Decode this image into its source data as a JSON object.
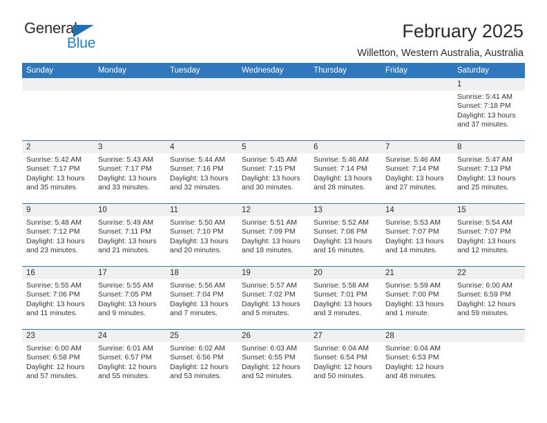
{
  "brand": {
    "name_part1": "General",
    "name_part2": "Blue",
    "triangle_color": "#1d6fb8",
    "blue_text_color": "#1d7fd4"
  },
  "header": {
    "title": "February 2025",
    "subtitle": "Willetton, Western Australia, Australia"
  },
  "theme": {
    "header_blue": "#2f78bd",
    "daynum_gray": "#f0f0f0",
    "text": "#2b2b2b"
  },
  "weekday_headers": [
    "Sunday",
    "Monday",
    "Tuesday",
    "Wednesday",
    "Thursday",
    "Friday",
    "Saturday"
  ],
  "labels": {
    "sunrise": "Sunrise:",
    "sunset": "Sunset:",
    "daylight": "Daylight:"
  },
  "weeks": [
    [
      {
        "empty": true,
        "day": ""
      },
      {
        "empty": true,
        "day": ""
      },
      {
        "empty": true,
        "day": ""
      },
      {
        "empty": true,
        "day": ""
      },
      {
        "empty": true,
        "day": ""
      },
      {
        "empty": true,
        "day": ""
      },
      {
        "day": "1",
        "sunrise": "Sunrise: 5:41 AM",
        "sunset": "Sunset: 7:18 PM",
        "daylight_line1": "Daylight: 13 hours",
        "daylight_line2": "and 37 minutes."
      }
    ],
    [
      {
        "day": "2",
        "sunrise": "Sunrise: 5:42 AM",
        "sunset": "Sunset: 7:17 PM",
        "daylight_line1": "Daylight: 13 hours",
        "daylight_line2": "and 35 minutes."
      },
      {
        "day": "3",
        "sunrise": "Sunrise: 5:43 AM",
        "sunset": "Sunset: 7:17 PM",
        "daylight_line1": "Daylight: 13 hours",
        "daylight_line2": "and 33 minutes."
      },
      {
        "day": "4",
        "sunrise": "Sunrise: 5:44 AM",
        "sunset": "Sunset: 7:16 PM",
        "daylight_line1": "Daylight: 13 hours",
        "daylight_line2": "and 32 minutes."
      },
      {
        "day": "5",
        "sunrise": "Sunrise: 5:45 AM",
        "sunset": "Sunset: 7:15 PM",
        "daylight_line1": "Daylight: 13 hours",
        "daylight_line2": "and 30 minutes."
      },
      {
        "day": "6",
        "sunrise": "Sunrise: 5:46 AM",
        "sunset": "Sunset: 7:14 PM",
        "daylight_line1": "Daylight: 13 hours",
        "daylight_line2": "and 28 minutes."
      },
      {
        "day": "7",
        "sunrise": "Sunrise: 5:46 AM",
        "sunset": "Sunset: 7:14 PM",
        "daylight_line1": "Daylight: 13 hours",
        "daylight_line2": "and 27 minutes."
      },
      {
        "day": "8",
        "sunrise": "Sunrise: 5:47 AM",
        "sunset": "Sunset: 7:13 PM",
        "daylight_line1": "Daylight: 13 hours",
        "daylight_line2": "and 25 minutes."
      }
    ],
    [
      {
        "day": "9",
        "sunrise": "Sunrise: 5:48 AM",
        "sunset": "Sunset: 7:12 PM",
        "daylight_line1": "Daylight: 13 hours",
        "daylight_line2": "and 23 minutes."
      },
      {
        "day": "10",
        "sunrise": "Sunrise: 5:49 AM",
        "sunset": "Sunset: 7:11 PM",
        "daylight_line1": "Daylight: 13 hours",
        "daylight_line2": "and 21 minutes."
      },
      {
        "day": "11",
        "sunrise": "Sunrise: 5:50 AM",
        "sunset": "Sunset: 7:10 PM",
        "daylight_line1": "Daylight: 13 hours",
        "daylight_line2": "and 20 minutes."
      },
      {
        "day": "12",
        "sunrise": "Sunrise: 5:51 AM",
        "sunset": "Sunset: 7:09 PM",
        "daylight_line1": "Daylight: 13 hours",
        "daylight_line2": "and 18 minutes."
      },
      {
        "day": "13",
        "sunrise": "Sunrise: 5:52 AM",
        "sunset": "Sunset: 7:08 PM",
        "daylight_line1": "Daylight: 13 hours",
        "daylight_line2": "and 16 minutes."
      },
      {
        "day": "14",
        "sunrise": "Sunrise: 5:53 AM",
        "sunset": "Sunset: 7:07 PM",
        "daylight_line1": "Daylight: 13 hours",
        "daylight_line2": "and 14 minutes."
      },
      {
        "day": "15",
        "sunrise": "Sunrise: 5:54 AM",
        "sunset": "Sunset: 7:07 PM",
        "daylight_line1": "Daylight: 13 hours",
        "daylight_line2": "and 12 minutes."
      }
    ],
    [
      {
        "day": "16",
        "sunrise": "Sunrise: 5:55 AM",
        "sunset": "Sunset: 7:06 PM",
        "daylight_line1": "Daylight: 13 hours",
        "daylight_line2": "and 11 minutes."
      },
      {
        "day": "17",
        "sunrise": "Sunrise: 5:55 AM",
        "sunset": "Sunset: 7:05 PM",
        "daylight_line1": "Daylight: 13 hours",
        "daylight_line2": "and 9 minutes."
      },
      {
        "day": "18",
        "sunrise": "Sunrise: 5:56 AM",
        "sunset": "Sunset: 7:04 PM",
        "daylight_line1": "Daylight: 13 hours",
        "daylight_line2": "and 7 minutes."
      },
      {
        "day": "19",
        "sunrise": "Sunrise: 5:57 AM",
        "sunset": "Sunset: 7:02 PM",
        "daylight_line1": "Daylight: 13 hours",
        "daylight_line2": "and 5 minutes."
      },
      {
        "day": "20",
        "sunrise": "Sunrise: 5:58 AM",
        "sunset": "Sunset: 7:01 PM",
        "daylight_line1": "Daylight: 13 hours",
        "daylight_line2": "and 3 minutes."
      },
      {
        "day": "21",
        "sunrise": "Sunrise: 5:59 AM",
        "sunset": "Sunset: 7:00 PM",
        "daylight_line1": "Daylight: 13 hours",
        "daylight_line2": "and 1 minute."
      },
      {
        "day": "22",
        "sunrise": "Sunrise: 6:00 AM",
        "sunset": "Sunset: 6:59 PM",
        "daylight_line1": "Daylight: 12 hours",
        "daylight_line2": "and 59 minutes."
      }
    ],
    [
      {
        "day": "23",
        "sunrise": "Sunrise: 6:00 AM",
        "sunset": "Sunset: 6:58 PM",
        "daylight_line1": "Daylight: 12 hours",
        "daylight_line2": "and 57 minutes."
      },
      {
        "day": "24",
        "sunrise": "Sunrise: 6:01 AM",
        "sunset": "Sunset: 6:57 PM",
        "daylight_line1": "Daylight: 12 hours",
        "daylight_line2": "and 55 minutes."
      },
      {
        "day": "25",
        "sunrise": "Sunrise: 6:02 AM",
        "sunset": "Sunset: 6:56 PM",
        "daylight_line1": "Daylight: 12 hours",
        "daylight_line2": "and 53 minutes."
      },
      {
        "day": "26",
        "sunrise": "Sunrise: 6:03 AM",
        "sunset": "Sunset: 6:55 PM",
        "daylight_line1": "Daylight: 12 hours",
        "daylight_line2": "and 52 minutes."
      },
      {
        "day": "27",
        "sunrise": "Sunrise: 6:04 AM",
        "sunset": "Sunset: 6:54 PM",
        "daylight_line1": "Daylight: 12 hours",
        "daylight_line2": "and 50 minutes."
      },
      {
        "day": "28",
        "sunrise": "Sunrise: 6:04 AM",
        "sunset": "Sunset: 6:53 PM",
        "daylight_line1": "Daylight: 12 hours",
        "daylight_line2": "and 48 minutes."
      },
      {
        "empty": true,
        "day": ""
      }
    ]
  ]
}
